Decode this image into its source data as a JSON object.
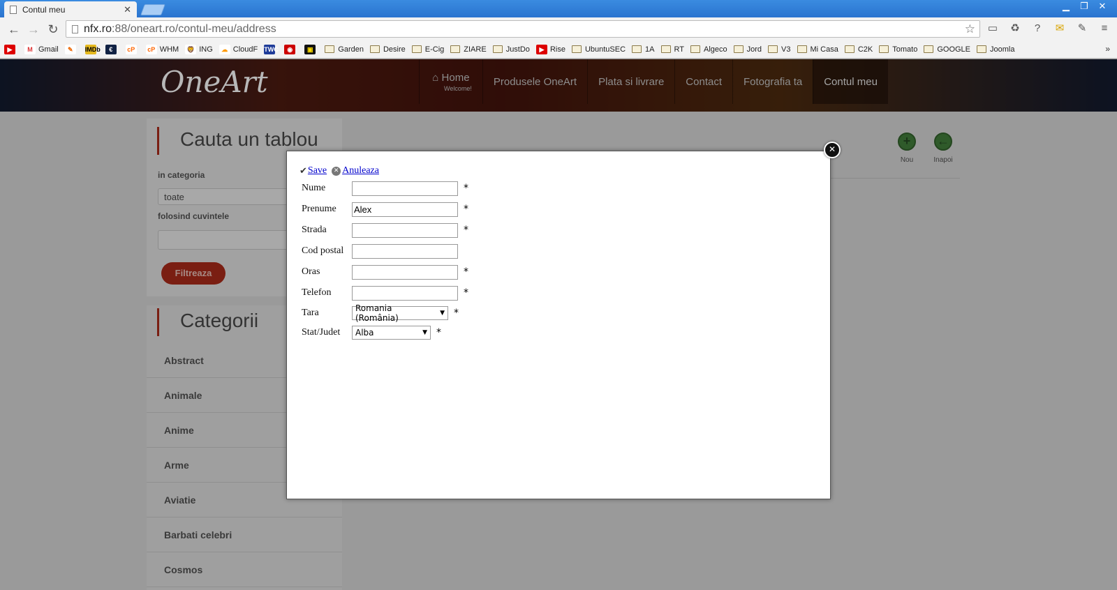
{
  "browser": {
    "tab_title": "Contul meu",
    "url_host": "nfx.ro",
    "url_path": ":88/oneart.ro/contul-meu/address",
    "bookmarks": [
      {
        "label": "",
        "type": "youtube"
      },
      {
        "label": "Gmail",
        "type": "gmail"
      },
      {
        "label": "",
        "type": "brush"
      },
      {
        "label": "",
        "type": "imdb"
      },
      {
        "label": "",
        "type": "euro"
      },
      {
        "label": "",
        "type": "cp"
      },
      {
        "label": "WHM",
        "type": "cp"
      },
      {
        "label": "ING",
        "type": "ing"
      },
      {
        "label": "CloudF",
        "type": "cloud"
      },
      {
        "label": "",
        "type": "twc"
      },
      {
        "label": "",
        "type": "target"
      },
      {
        "label": "",
        "type": "black"
      },
      {
        "label": "Garden",
        "type": "folder"
      },
      {
        "label": "Desire",
        "type": "folder"
      },
      {
        "label": "E-Cig",
        "type": "folder"
      },
      {
        "label": "ZIARE",
        "type": "folder"
      },
      {
        "label": "JustDo",
        "type": "folder"
      },
      {
        "label": "Rise",
        "type": "youtube"
      },
      {
        "label": "UbuntuSEC",
        "type": "folder"
      },
      {
        "label": "1A",
        "type": "folder"
      },
      {
        "label": "RT",
        "type": "folder"
      },
      {
        "label": "Algeco",
        "type": "folder"
      },
      {
        "label": "Jord",
        "type": "folder"
      },
      {
        "label": "V3",
        "type": "folder"
      },
      {
        "label": "Mi Casa",
        "type": "folder"
      },
      {
        "label": "C2K",
        "type": "folder"
      },
      {
        "label": "Tomato",
        "type": "folder"
      },
      {
        "label": "GOOGLE",
        "type": "folder"
      },
      {
        "label": "Joomla",
        "type": "folder"
      }
    ],
    "bookmarks_more": "»",
    "cp_label": "cP",
    "imdb_label": "IMDb",
    "twc_label": "TWC"
  },
  "site": {
    "logo": "OneArt",
    "nav": [
      {
        "label": "Home",
        "sub": "Welcome!"
      },
      {
        "label": "Produsele OneArt"
      },
      {
        "label": "Plata si livrare"
      },
      {
        "label": "Contact"
      },
      {
        "label": "Fotografia ta"
      },
      {
        "label": "Contul meu"
      }
    ],
    "search": {
      "title": "Cauta un tablou",
      "category_label": "in categoria",
      "category_value": "toate",
      "words_label": "folosind cuvintele",
      "filter_button": "Filtreaza"
    },
    "categories": {
      "title": "Categorii",
      "items": [
        "Abstract",
        "Animale",
        "Anime",
        "Arme",
        "Aviatie",
        "Barbati celebri",
        "Cosmos"
      ]
    },
    "actions": {
      "new_label": "Nou",
      "back_label": "Inapoi"
    }
  },
  "modal": {
    "save_label": "Save",
    "cancel_label": "Anuleaza",
    "required_mark": "*",
    "fields": [
      {
        "label": "Nume",
        "value": "",
        "required": true
      },
      {
        "label": "Prenume",
        "value": "Alex",
        "required": true
      },
      {
        "label": "Strada",
        "value": "",
        "required": true
      },
      {
        "label": "Cod postal",
        "value": "",
        "required": false
      },
      {
        "label": "Oras",
        "value": "",
        "required": true
      },
      {
        "label": "Telefon",
        "value": "",
        "required": true
      }
    ],
    "tara_label": "Tara",
    "tara_value": "Romania (România)",
    "judet_label": "Stat/Judet",
    "judet_value": "Alba"
  }
}
